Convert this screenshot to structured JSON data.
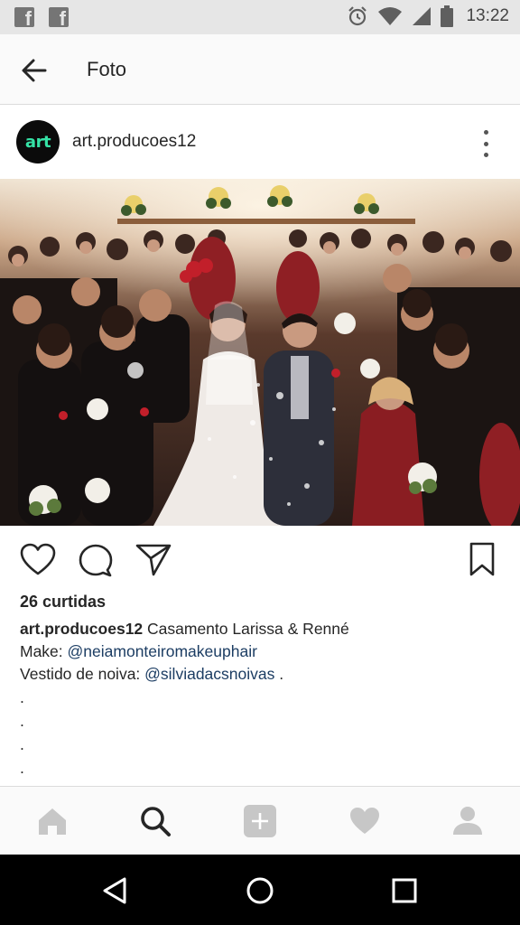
{
  "status_bar": {
    "left_icons": [
      "facebook-icon",
      "facebook-icon"
    ],
    "right_icons": [
      "alarm-icon",
      "wifi-icon",
      "cell-signal-icon",
      "battery-icon"
    ],
    "time": "13:22"
  },
  "app_bar": {
    "back_icon": "arrow-back-icon",
    "title": "Foto"
  },
  "post": {
    "avatar_text": "art",
    "username": "art.producoes12",
    "more_icon": "more-vertical-icon",
    "actions": [
      "heart-icon",
      "comment-icon",
      "share-icon",
      "bookmark-icon"
    ],
    "likes": "26 curtidas",
    "caption": {
      "author": "art.producoes12",
      "text": " Casamento Larissa & Renné",
      "make_label": "Make: ",
      "make_mention": "@neiamonteiromakeuphair",
      "dress_label": "Vestido de noiva: ",
      "dress_mention": "@silviadacsnoivas",
      "dress_suffix": " .",
      "dots": [
        ".",
        ".",
        ".",
        "."
      ]
    }
  },
  "tab_bar": {
    "tabs": [
      "home-icon",
      "search-icon",
      "add-icon",
      "activity-heart-icon",
      "profile-icon"
    ],
    "accent": "#262626",
    "inactive": "#c7c7c7"
  },
  "nav_bar": {
    "buttons": [
      "back-triangle-icon",
      "home-circle-icon",
      "recents-square-icon"
    ]
  }
}
